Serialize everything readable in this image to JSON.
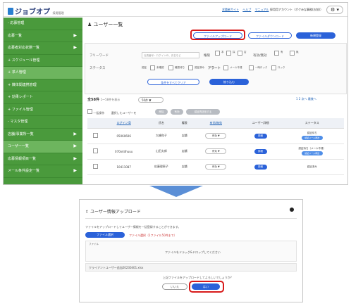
{
  "header": {
    "logo_text": "ジョブオプ",
    "logo_sub": "採用管理",
    "links": [
      "求職者サイト",
      "ヘルプ",
      "マニュアル"
    ],
    "account": "採用用アカウント（ボクみな事務(お前)）",
    "gear_icon": "gear-icon"
  },
  "sidebar": {
    "items": [
      {
        "label": "- 応募管理",
        "arrow": ""
      },
      {
        "label": "応募一覧",
        "arrow": "▶"
      },
      {
        "label": "応募者対応状態一覧",
        "arrow": "▶"
      },
      {
        "label": "+ スケジュール管理",
        "arrow": ""
      },
      {
        "label": "+ 求人管理",
        "arrow": ""
      },
      {
        "label": "+ 媒体間連携管理",
        "arrow": ""
      },
      {
        "label": "+ 効果レポート",
        "arrow": ""
      },
      {
        "label": "+ ファイル管理",
        "arrow": ""
      },
      {
        "label": "- マスタ管理",
        "arrow": ""
      },
      {
        "label": "店舗/事業所一覧",
        "arrow": "▶"
      },
      {
        "label": "ユーザー一覧",
        "arrow": "▶"
      },
      {
        "label": "応募情報項目一覧",
        "arrow": "▶"
      },
      {
        "label": "メール条件設定一覧",
        "arrow": "▶"
      }
    ]
  },
  "main": {
    "title": "ユーザー一覧",
    "buttons": {
      "upload": "ファイルアップロード",
      "download": "ファイルダウンロード",
      "new": "新規登録"
    },
    "search": {
      "freeword_label": "フリーワード",
      "freeword_placeholder": "社員番号・ログインID、氏名など",
      "auth_label": "権限",
      "auth_options": [
        "本",
        "本",
        "採",
        "採",
        "店",
        "店"
      ],
      "enable_label": "有効/無効",
      "enable_options": [
        "有",
        "無",
        "有",
        "無"
      ],
      "status_label": "ステータス",
      "status_options": [
        "未確認",
        "確認待ち",
        "認証済み"
      ],
      "alert_label": "アラート",
      "alert_options": [
        "メール不達",
        "一時ロック",
        "ロック"
      ],
      "status_first": "認証",
      "clear_button": "条件をすべてクリア",
      "apply_button": "絞り込む"
    },
    "count_text": "全58件",
    "count_sub": "1〜58件を表示",
    "per_page": "50件",
    "pager": "1 2 次へ 最後へ",
    "bulk_label": "一括操作",
    "bulk_selected": "選択したユーザーを",
    "bulk_buttons": [
      "削除",
      "有効",
      "認証再送信する"
    ],
    "table": {
      "headers": [
        "",
        "ログインID",
        "氏名",
        "権限",
        "有効/無効",
        "ユーザー詳細",
        "ステータス"
      ],
      "rows": [
        {
          "id": "05060606",
          "name": "大峰和子",
          "auth": "店舗",
          "enabled": "有効",
          "detail": "詳細",
          "status": "認証待ち",
          "status_btn": "認証メール再送"
        },
        {
          "id": "070o4dhuuu",
          "name": "山田太郎",
          "auth": "店舗",
          "enabled": "有効",
          "detail": "詳細",
          "status": "認証待ち（メール不達）",
          "status_btn": "認証メール再送"
        },
        {
          "id": "10411087",
          "name": "佐藤理恵子",
          "auth": "店舗",
          "enabled": "有効",
          "detail": "詳細",
          "status": "認証済み",
          "status_btn": ""
        }
      ]
    }
  },
  "modal": {
    "title": "ユーザー情報アップロード",
    "desc": "ファイルをアップロードしてユーザー情報を一括登録することができます。",
    "file_select": "ファイル選択",
    "file_note": "ファイル選択（1ファイル50件まで）",
    "dropzone_label": "ファイルをドラッグ&ドロップしてください",
    "dropzone_header": "ファイル",
    "file_name": "クライアントユーザー追加20230401.xlsx",
    "confirm_text": "上記ファイルをアップロードしてよろしいでしょうか？",
    "no_button": "いいえ",
    "yes_button": "はい"
  },
  "colors": {
    "sidebar": "#4a9a3c",
    "primary": "#2b62d9",
    "highlight": "#d81a1a",
    "arrow": "#5b8fd6"
  }
}
